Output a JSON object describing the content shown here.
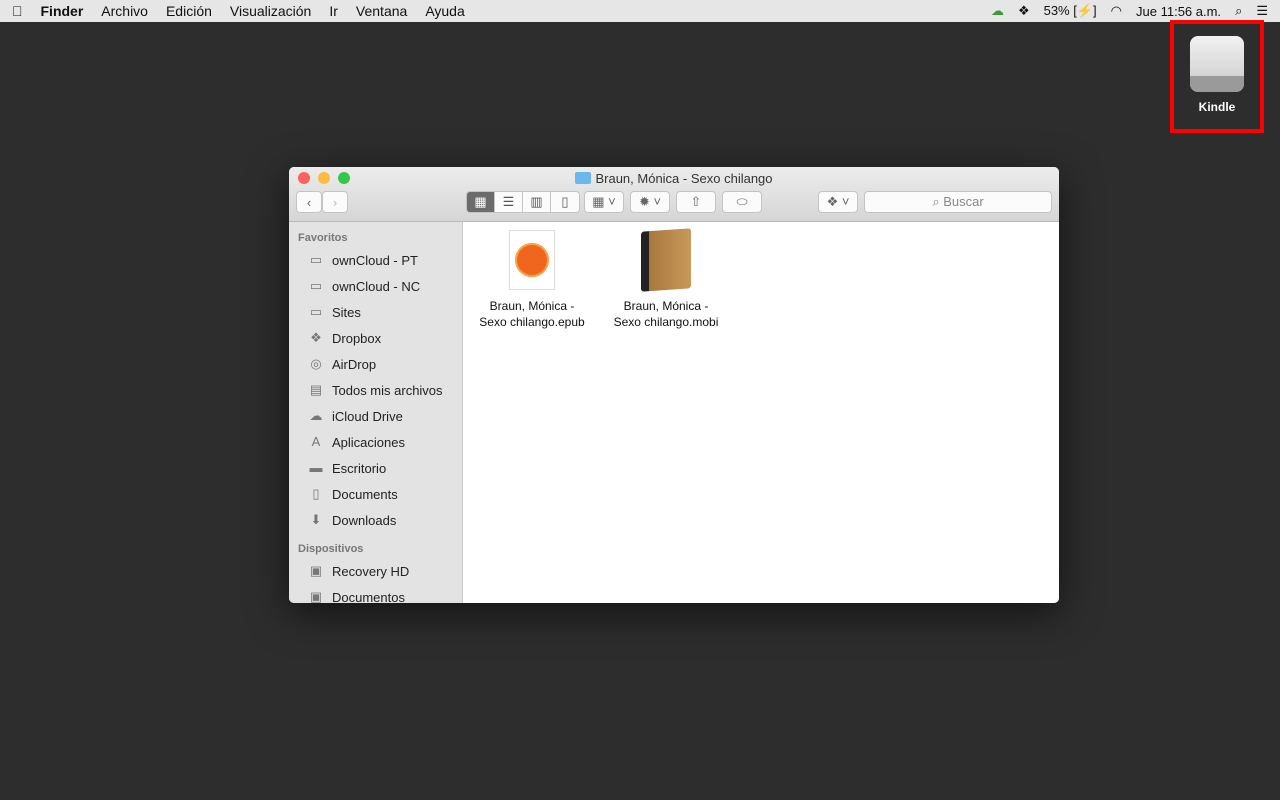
{
  "menubar": {
    "apple": "",
    "app": "Finder",
    "items": [
      "Archivo",
      "Edición",
      "Visualización",
      "Ir",
      "Ventana",
      "Ayuda"
    ],
    "battery": "53%",
    "clock": "Jue 11:56 a.m."
  },
  "desktop": {
    "kindle_label": "Kindle",
    "highlight_color": "#ff0000"
  },
  "window": {
    "title": "Braun, Mónica - Sexo chilango",
    "search_placeholder": "Buscar",
    "sidebar": {
      "favorites_header": "Favoritos",
      "favorites": [
        {
          "label": "ownCloud - PT",
          "icon": "folder-icon"
        },
        {
          "label": "ownCloud - NC",
          "icon": "folder-icon"
        },
        {
          "label": "Sites",
          "icon": "folder-icon"
        },
        {
          "label": "Dropbox",
          "icon": "dropbox-icon"
        },
        {
          "label": "AirDrop",
          "icon": "airdrop-icon"
        },
        {
          "label": "Todos mis archivos",
          "icon": "all-files-icon"
        },
        {
          "label": "iCloud Drive",
          "icon": "cloud-icon"
        },
        {
          "label": "Aplicaciones",
          "icon": "applications-icon"
        },
        {
          "label": "Escritorio",
          "icon": "desktop-icon"
        },
        {
          "label": "Documents",
          "icon": "documents-icon"
        },
        {
          "label": "Downloads",
          "icon": "downloads-icon"
        }
      ],
      "devices_header": "Dispositivos",
      "devices": [
        {
          "label": "Recovery HD",
          "icon": "disk-icon"
        },
        {
          "label": "Documentos",
          "icon": "disk-icon"
        }
      ]
    },
    "files": [
      {
        "line1": "Braun, Mónica -",
        "line2": "Sexo chilango.epub"
      },
      {
        "line1": "Braun, Mónica -",
        "line2": "Sexo chilango.mobi"
      }
    ]
  }
}
